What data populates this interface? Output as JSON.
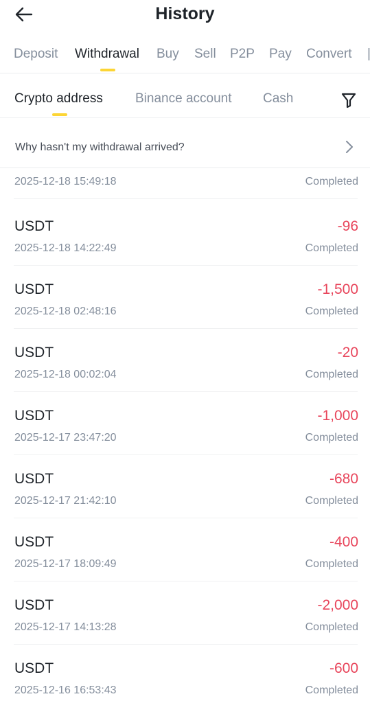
{
  "header": {
    "title": "History"
  },
  "primary_tabs": [
    "Deposit",
    "Withdrawal",
    "Buy",
    "Sell",
    "P2P",
    "Pay",
    "Convert"
  ],
  "primary_active": "Withdrawal",
  "secondary_tabs": [
    "Crypto address",
    "Binance account",
    "Cash"
  ],
  "secondary_active": "Crypto address",
  "help": {
    "text": "Why hasn't my withdrawal arrived?"
  },
  "partial_row": {
    "timestamp": "2025-12-18 15:49:18",
    "status": "Completed"
  },
  "transactions": [
    {
      "coin": "USDT",
      "amount": "-96",
      "timestamp": "2025-12-18 14:22:49",
      "status": "Completed"
    },
    {
      "coin": "USDT",
      "amount": "-1,500",
      "timestamp": "2025-12-18 02:48:16",
      "status": "Completed"
    },
    {
      "coin": "USDT",
      "amount": "-20",
      "timestamp": "2025-12-18 00:02:04",
      "status": "Completed"
    },
    {
      "coin": "USDT",
      "amount": "-1,000",
      "timestamp": "2025-12-17 23:47:20",
      "status": "Completed"
    },
    {
      "coin": "USDT",
      "amount": "-680",
      "timestamp": "2025-12-17 21:42:10",
      "status": "Completed"
    },
    {
      "coin": "USDT",
      "amount": "-400",
      "timestamp": "2025-12-17 18:09:49",
      "status": "Completed"
    },
    {
      "coin": "USDT",
      "amount": "-2,000",
      "timestamp": "2025-12-17 14:13:28",
      "status": "Completed"
    },
    {
      "coin": "USDT",
      "amount": "-600",
      "timestamp": "2025-12-16 16:53:43",
      "status": "Completed"
    }
  ],
  "colors": {
    "accent": "#fcd535",
    "negative": "#e8455b",
    "text_primary": "#1e2329",
    "text_secondary": "#848e9c"
  },
  "icons": {
    "back": "arrow-left-icon",
    "filter": "filter-icon",
    "chevron": "chevron-right-icon"
  }
}
